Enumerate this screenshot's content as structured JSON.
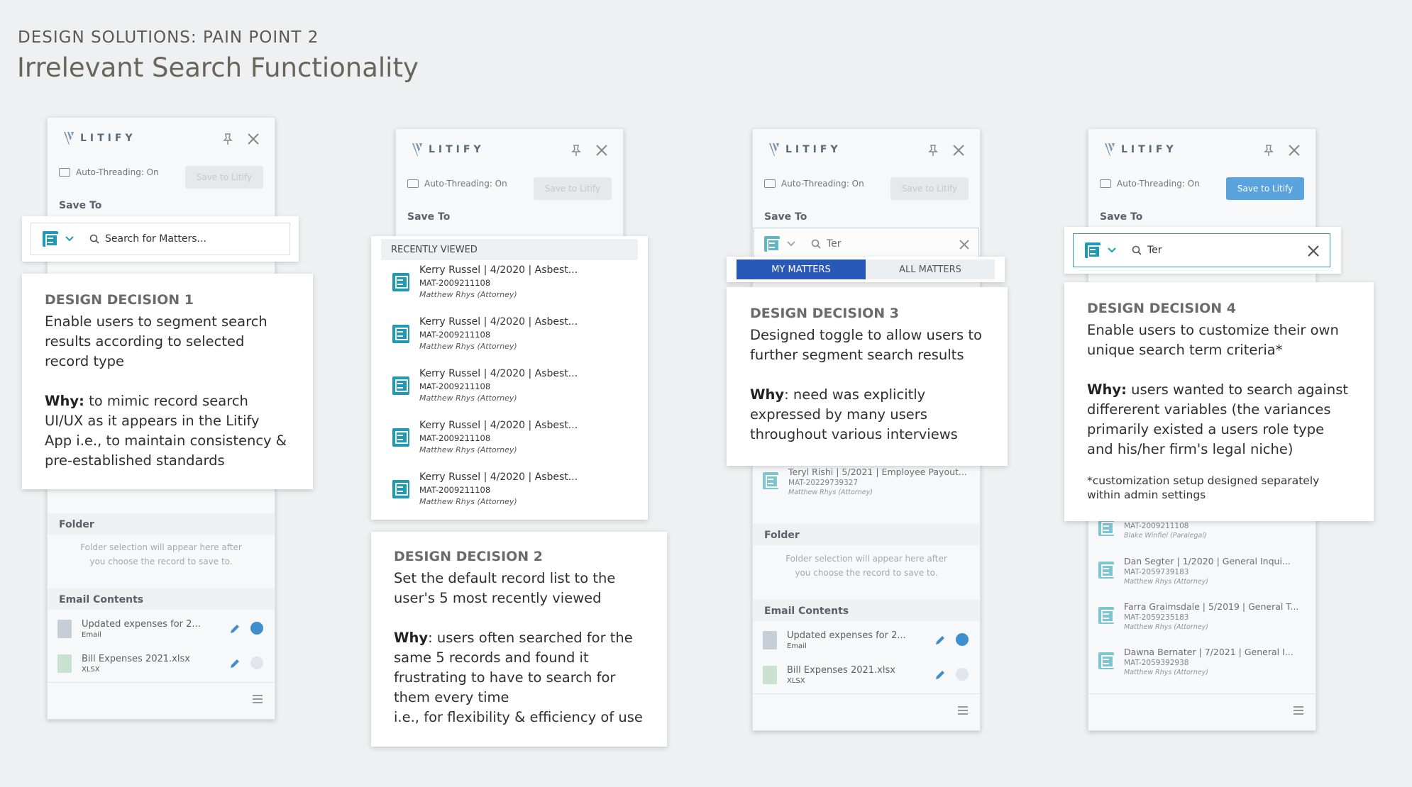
{
  "header": {
    "kicker": "DESIGN SOLUTIONS: PAIN POINT 2",
    "title": "Irrelevant Search Functionality"
  },
  "panel": {
    "brand": "LITIFY",
    "auto_threading": "Auto-Threading: On",
    "save_button": "Save to Litify",
    "save_to_label": "Save To",
    "folder_label": "Folder",
    "folder_hint_1": "Folder selection will appear here after",
    "folder_hint_2": "you choose the record to save to.",
    "email_contents_label": "Email Contents",
    "files": [
      {
        "title": "Updated expenses for 2...",
        "type": "Email",
        "badge": "EMAIL"
      },
      {
        "title": "Bill Expenses 2021.xlsx",
        "type": "XLSX",
        "badge": "EXCEL"
      }
    ]
  },
  "search": {
    "placeholder": "Search for Matters...",
    "query": "Ter"
  },
  "recently_viewed": {
    "heading": "RECENTLY VIEWED",
    "items": [
      {
        "title": "Kerry Russel | 4/2020 | Asbest...",
        "id": "MAT-2009211108",
        "person": "Matthew Rhys (Attorney)"
      },
      {
        "title": "Kerry Russel | 4/2020 | Asbest...",
        "id": "MAT-2009211108",
        "person": "Matthew Rhys (Attorney)"
      },
      {
        "title": "Kerry Russel | 4/2020 | Asbest...",
        "id": "MAT-2009211108",
        "person": "Matthew Rhys (Attorney)"
      },
      {
        "title": "Kerry Russel | 4/2020 | Asbest...",
        "id": "MAT-2009211108",
        "person": "Matthew Rhys (Attorney)"
      },
      {
        "title": "Kerry Russel | 4/2020 | Asbest...",
        "id": "MAT-2009211108",
        "person": "Matthew Rhys (Attorney)"
      }
    ]
  },
  "toggle": {
    "my_matters": "MY MATTERS",
    "all_matters": "ALL MATTERS"
  },
  "panel3_result": {
    "title": "Teryl Rishi | 5/2021 | Employee Payout...",
    "id": "MAT-20229739327",
    "person": "Matthew Rhys (Attorney)"
  },
  "panel4_results": [
    {
      "title": "",
      "id": "MAT-2009211108",
      "person": "Blake Winfiel (Paralegal)"
    },
    {
      "title": "Dan Segter | 1/2020 | General Inqui...",
      "id": "MAT-2059739183",
      "person": "Matthew Rhys (Attorney)"
    },
    {
      "title": "Farra Graimsdale | 5/2019 | General T...",
      "id": "MAT-2059235183",
      "person": "Matthew Rhys (Attorney)"
    },
    {
      "title": "Dawna Bernater | 7/2021 | General I...",
      "id": "MAT-2059392938",
      "person": "Matthew Rhys (Attorney)"
    }
  ],
  "decisions": {
    "d1": {
      "heading": "DESIGN DECISION 1",
      "text": "Enable users to segment search results according to selected record type",
      "why_label": "Why:",
      "why": "to mimic record search UI/UX as it appears in the Litify App i.e., to maintain consistency & pre-established standards"
    },
    "d2": {
      "heading": "DESIGN DECISION 2",
      "text": "Set the default record list to the user's 5 most recently viewed",
      "why_label": "Why",
      "why": ": users often searched for the same 5 records and found it frustrating to have to search for them every time",
      "why2": "i.e., for flexibility & efficiency of use"
    },
    "d3": {
      "heading": "DESIGN DECISION 3",
      "text": "Designed  toggle to allow users to further segment search results",
      "why_label": "Why",
      "why": ": need was explicitly expressed by many users throughout various interviews"
    },
    "d4": {
      "heading": "DESIGN DECISION 4",
      "text": "Enable users to customize their own unique search term criteria*",
      "why_label": "Why:",
      "why": "users wanted to search against differerent variables (the variances primarily existed a users role type and his/her firm's legal niche)",
      "note": "*customization setup designed separately within admin settings"
    }
  },
  "colors": {
    "accent": "#1e9bb2",
    "toggle_active": "#2a58b8",
    "save_active": "#5ba3dc",
    "background": "#eef0f1"
  }
}
